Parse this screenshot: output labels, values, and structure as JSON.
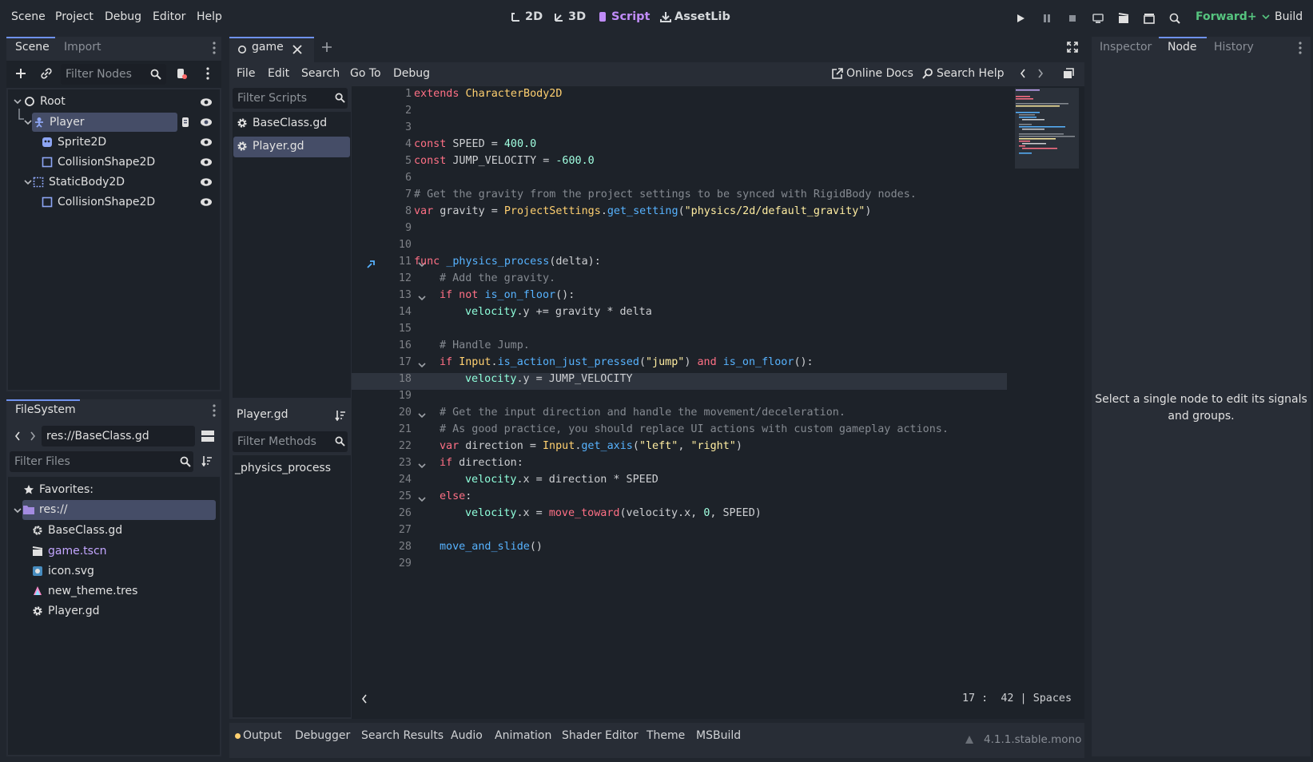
{
  "menubar": [
    "Scene",
    "Project",
    "Debug",
    "Editor",
    "Help"
  ],
  "workspaces": [
    "2D",
    "3D",
    "Script",
    "AssetLib"
  ],
  "renderer": "Forward+",
  "build_label": "Build",
  "scene_dock": {
    "tabs": [
      "Scene",
      "Import"
    ],
    "filter_placeholder": "Filter Nodes",
    "nodes": [
      "Root",
      "Player",
      "Sprite2D",
      "CollisionShape2D",
      "StaticBody2D",
      "CollisionShape2D"
    ]
  },
  "filesystem": {
    "tab": "FileSystem",
    "path": "res://BaseClass.gd",
    "filter_placeholder": "Filter Files",
    "favorites": "Favorites:",
    "root": "res://",
    "files": [
      "BaseClass.gd",
      "game.tscn",
      "icon.svg",
      "new_theme.tres",
      "Player.gd"
    ]
  },
  "editor_tab": "game",
  "script_menu": [
    "File",
    "Edit",
    "Search",
    "Go To",
    "Debug"
  ],
  "online_docs": "Online Docs",
  "search_help": "Search Help",
  "scripts": {
    "filter_placeholder": "Filter Scripts",
    "list": [
      "BaseClass.gd",
      "Player.gd"
    ],
    "current": "Player.gd",
    "methods_placeholder": "Filter Methods",
    "methods": [
      "_physics_process"
    ]
  },
  "status": {
    "line": "17",
    "col": "42",
    "indent": "Spaces"
  },
  "right_dock": {
    "tabs": [
      "Inspector",
      "Node",
      "History"
    ],
    "message": "Select a single node to edit its signals and groups."
  },
  "bottom_tabs": [
    "Output",
    "Debugger",
    "Search Results",
    "Audio",
    "Animation",
    "Shader Editor",
    "Theme",
    "MSBuild"
  ],
  "version": "4.1.1.stable.mono",
  "line_numbers": [
    "1",
    "2",
    "3",
    "4",
    "5",
    "6",
    "7",
    "8",
    "9",
    "10",
    "11",
    "12",
    "13",
    "14",
    "15",
    "16",
    "17",
    "18",
    "19",
    "20",
    "21",
    "22",
    "23",
    "24",
    "25",
    "26",
    "27",
    "28",
    "29"
  ],
  "code": {
    "l1a": "extends",
    "l1b": "CharacterBody2D",
    "l4a": "const",
    "l4b": " SPEED = ",
    "l4c": "400.0",
    "l5a": "const",
    "l5b": " JUMP_VELOCITY = ",
    "l5c": "-600.0",
    "l7": "# Get the gravity from the project settings to be synced with RigidBody nodes.",
    "l8a": "var",
    "l8b": " gravity = ",
    "l8c": "ProjectSettings",
    "l8d": ".",
    "l8e": "get_setting",
    "l8f": "(",
    "l8g": "\"physics/2d/default_gravity\"",
    "l8h": ")",
    "l11a": "func",
    "l11b": " ",
    "l11c": "_physics_process",
    "l11d": "(delta):",
    "l12": "# Add the gravity.",
    "l13a": "if not",
    "l13b": " ",
    "l13c": "is_on_floor",
    "l13d": "():",
    "l14a": "velocity",
    "l14b": ".y += gravity * delta",
    "l16": "# Handle Jump.",
    "l17a": "if",
    "l17b": " ",
    "l17c": "Input",
    "l17d": ".",
    "l17e": "is_action_just_pressed",
    "l17f": "(",
    "l17g": "\"jump\"",
    "l17h": ") ",
    "l17i": "and",
    "l17j": " ",
    "l17k": "is_on_floor",
    "l17l": "():",
    "l18a": "velocity",
    "l18b": ".y = JUMP_VELOCITY",
    "l20": "# Get the input direction and handle the movement/deceleration.",
    "l21": "# As good practice, you should replace UI actions with custom gameplay actions.",
    "l22a": "var",
    "l22b": " direction = ",
    "l22c": "Input",
    "l22d": ".",
    "l22e": "get_axis",
    "l22f": "(",
    "l22g": "\"left\"",
    "l22h": ", ",
    "l22i": "\"right\"",
    "l22j": ")",
    "l23a": "if",
    "l23b": " direction:",
    "l24a": "velocity",
    "l24b": ".x = direction * SPEED",
    "l25a": "else",
    "l25b": ":",
    "l26a": "velocity",
    "l26b": ".x = ",
    "l26c": "move_toward",
    "l26d": "(velocity.x, ",
    "l26e": "0",
    "l26f": ", SPEED)",
    "l28a": "move_and_slide",
    "l28b": "()"
  },
  "icons": [
    "play-icon",
    "pause-icon",
    "stop-icon",
    "remote-icon",
    "movie-icon",
    "scene-icon",
    "search-icon",
    "eye-icon",
    "gear-icon"
  ]
}
